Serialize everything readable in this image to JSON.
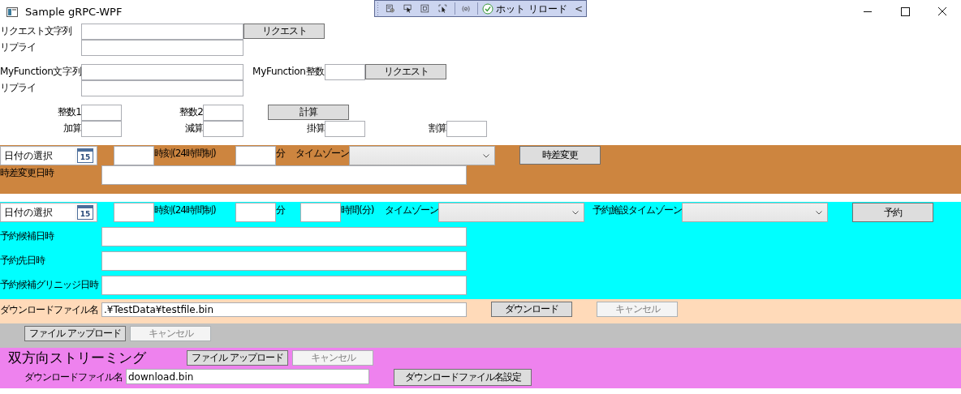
{
  "window": {
    "title": "Sample gRPC-WPF"
  },
  "debug_toolbar": {
    "hot_reload_label": "ホット リロード",
    "collapse_glyph": "<"
  },
  "sections": [
    {
      "rows": [
        {
          "items": [
            {
              "kind": "label",
              "text": "リクエスト文字列"
            },
            {
              "kind": "input"
            },
            {
              "kind": "button",
              "label": "リクエスト",
              "disabled": false
            }
          ]
        },
        {
          "items": [
            {
              "kind": "label",
              "text": "リプライ"
            },
            {
              "kind": "input"
            }
          ]
        },
        {
          "items": [
            {
              "kind": "label",
              "text": "MyFunction文字列"
            },
            {
              "kind": "input"
            },
            {
              "kind": "label",
              "text": "MyFunction整数"
            },
            {
              "kind": "input"
            },
            {
              "kind": "button",
              "label": "リクエスト",
              "disabled": false
            }
          ]
        },
        {
          "items": [
            {
              "kind": "label",
              "text": "リプライ"
            },
            {
              "kind": "input"
            }
          ]
        },
        {
          "items": [
            {
              "kind": "label",
              "text": "整数1"
            },
            {
              "kind": "input"
            },
            {
              "kind": "label",
              "text": "整数2"
            },
            {
              "kind": "input"
            },
            {
              "kind": "button",
              "label": "計算",
              "disabled": false
            }
          ]
        },
        {
          "items": [
            {
              "kind": "label",
              "text": "加算"
            },
            {
              "kind": "input"
            },
            {
              "kind": "label",
              "text": "減算"
            },
            {
              "kind": "input"
            },
            {
              "kind": "label",
              "text": "掛算"
            },
            {
              "kind": "input"
            },
            {
              "kind": "label",
              "text": "割算"
            },
            {
              "kind": "input"
            }
          ]
        }
      ]
    },
    {
      "rows": [
        {
          "items": [
            {
              "kind": "date",
              "placeholder": "日付の選択",
              "icon_text": "15"
            },
            {
              "kind": "input"
            },
            {
              "kind": "label",
              "text": "時刻(24時間制)"
            },
            {
              "kind": "input"
            },
            {
              "kind": "label",
              "text": "分"
            },
            {
              "kind": "label",
              "text": "タイムゾーン"
            },
            {
              "kind": "combo"
            },
            {
              "kind": "button",
              "label": "時差変更",
              "disabled": false
            }
          ]
        },
        {
          "items": [
            {
              "kind": "label",
              "text": "時差変更日時"
            },
            {
              "kind": "input"
            }
          ]
        }
      ]
    },
    {
      "rows": [
        {
          "items": [
            {
              "kind": "date",
              "placeholder": "日付の選択",
              "icon_text": "15"
            },
            {
              "kind": "input"
            },
            {
              "kind": "label",
              "text": "時刻(24時間制)"
            },
            {
              "kind": "input"
            },
            {
              "kind": "label",
              "text": "分"
            },
            {
              "kind": "input"
            },
            {
              "kind": "label",
              "text": "時間(分)"
            },
            {
              "kind": "label",
              "text": "タイムゾーン"
            },
            {
              "kind": "combo"
            },
            {
              "kind": "label",
              "text": "予約施設タイムゾーン"
            },
            {
              "kind": "combo"
            },
            {
              "kind": "button",
              "label": "予約",
              "disabled": false
            }
          ]
        },
        {
          "items": [
            {
              "kind": "label",
              "text": "予約候補日時"
            },
            {
              "kind": "input"
            }
          ]
        },
        {
          "items": [
            {
              "kind": "label",
              "text": "予約先日時"
            },
            {
              "kind": "input"
            }
          ]
        },
        {
          "items": [
            {
              "kind": "label",
              "text": "予約候補グリニッジ日時"
            },
            {
              "kind": "input"
            }
          ]
        }
      ]
    },
    {
      "rows": [
        {
          "items": [
            {
              "kind": "label",
              "text": "ダウンロードファイル名"
            },
            {
              "kind": "input",
              "value": ".¥TestData¥testfile.bin"
            },
            {
              "kind": "button",
              "label": "ダウンロード",
              "disabled": false
            },
            {
              "kind": "button",
              "label": "キャンセル",
              "disabled": true
            }
          ]
        }
      ]
    },
    {
      "rows": [
        {
          "items": [
            {
              "kind": "button",
              "label": "ファイル アップロード",
              "disabled": false
            },
            {
              "kind": "button",
              "label": "キャンセル",
              "disabled": true
            }
          ]
        }
      ]
    },
    {
      "rows": [
        {
          "items": [
            {
              "kind": "heading",
              "text": "双方向ストリーミング"
            },
            {
              "kind": "button",
              "label": "ファイル アップロード",
              "disabled": false
            },
            {
              "kind": "button",
              "label": "キャンセル",
              "disabled": true
            }
          ]
        },
        {
          "items": [
            {
              "kind": "label",
              "text": "ダウンロードファイル名"
            },
            {
              "kind": "input",
              "value": "download.bin"
            },
            {
              "kind": "button",
              "label": "ダウンロードファイル名設定",
              "disabled": false
            }
          ]
        }
      ]
    }
  ]
}
